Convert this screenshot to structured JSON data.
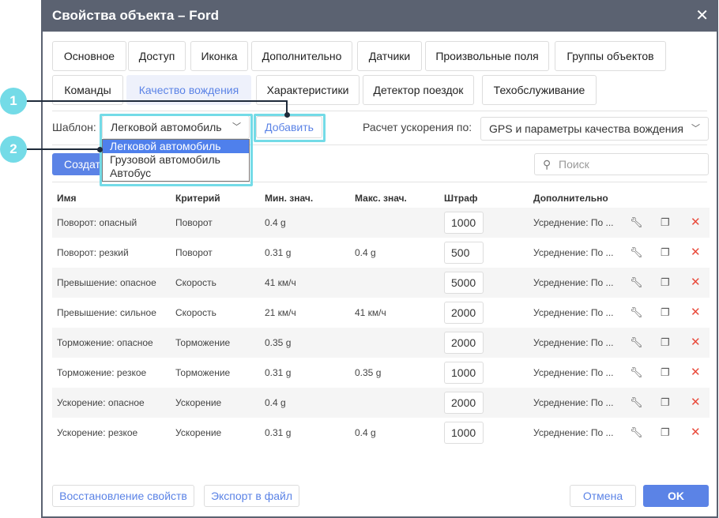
{
  "title": "Свойства объекта – Ford",
  "tabs_row1": [
    "Основное",
    "Доступ",
    "Иконка",
    "Дополнительно",
    "Датчики",
    "Произвольные поля",
    "Группы объектов"
  ],
  "tabs_row2": [
    "Команды",
    "Качество вождения",
    "Характеристики",
    "Детектор поездок",
    "Техобслуживание"
  ],
  "template_label": "Шаблон:",
  "template_value": "Легковой автомобиль",
  "template_options": [
    "Легковой автомобиль",
    "Грузовой автомобиль",
    "Автобус"
  ],
  "add_button": "Добавить",
  "accel_label": "Расчет ускорения по:",
  "accel_value": "GPS и параметры качества вождения",
  "create_button": "Создать",
  "search_placeholder": "Поиск",
  "columns": [
    "Имя",
    "Критерий",
    "Мин. знач.",
    "Макс. знач.",
    "Штраф",
    "Дополнительно"
  ],
  "rows": [
    {
      "name": "Поворот: опасный",
      "criterion": "Поворот",
      "min": "0.4 g",
      "max": "",
      "penalty": "1000",
      "extra": "Усреднение: По ..."
    },
    {
      "name": "Поворот: резкий",
      "criterion": "Поворот",
      "min": "0.31 g",
      "max": "0.4 g",
      "penalty": "500",
      "extra": "Усреднение: По ..."
    },
    {
      "name": "Превышение: опасное",
      "criterion": "Скорость",
      "min": "41 км/ч",
      "max": "",
      "penalty": "5000",
      "extra": "Усреднение: По ..."
    },
    {
      "name": "Превышение: сильное",
      "criterion": "Скорость",
      "min": "21 км/ч",
      "max": "41 км/ч",
      "penalty": "2000",
      "extra": "Усреднение: По ..."
    },
    {
      "name": "Торможение: опасное",
      "criterion": "Торможение",
      "min": "0.35 g",
      "max": "",
      "penalty": "2000",
      "extra": "Усреднение: По ..."
    },
    {
      "name": "Торможение: резкое",
      "criterion": "Торможение",
      "min": "0.31 g",
      "max": "0.35 g",
      "penalty": "1000",
      "extra": "Усреднение: По ..."
    },
    {
      "name": "Ускорение: опасное",
      "criterion": "Ускорение",
      "min": "0.4 g",
      "max": "",
      "penalty": "2000",
      "extra": "Усреднение: По ..."
    },
    {
      "name": "Ускорение: резкое",
      "criterion": "Ускорение",
      "min": "0.31 g",
      "max": "0.4 g",
      "penalty": "1000",
      "extra": "Усреднение: По ..."
    }
  ],
  "footer": {
    "restore": "Восстановление свойств",
    "export": "Экспорт в файл",
    "cancel": "Отмена",
    "ok": "OK"
  },
  "callouts": [
    "1",
    "2"
  ]
}
